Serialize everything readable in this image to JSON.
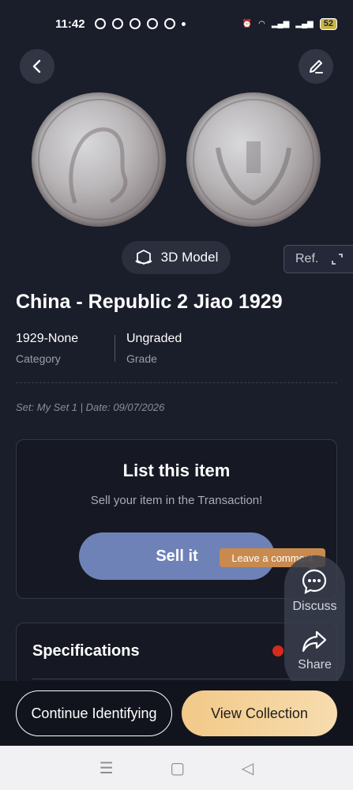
{
  "status": {
    "time": "11:42",
    "battery": "52"
  },
  "item": {
    "title": "China - Republic 2 Jiao 1929",
    "category_value": "1929-None",
    "category_label": "Category",
    "grade_value": "Ungraded",
    "grade_label": "Grade",
    "set_line": "Set: My Set 1 | Date: 09/07/2026"
  },
  "actions": {
    "model_3d": "3D Model",
    "ref": "Ref."
  },
  "list_card": {
    "title": "List this item",
    "subtitle": "Sell your item in the Transaction!",
    "sell_button": "Sell it"
  },
  "tooltip": "Leave a comment",
  "side_panel": {
    "discuss": "Discuss",
    "share": "Share"
  },
  "specs": {
    "title": "Specifications"
  },
  "footer": {
    "continue": "Continue Identifying",
    "view": "View Collection"
  },
  "colors": {
    "background": "#1a1d2a",
    "sell_button": "#6e82b8",
    "tooltip": "#c88a4e",
    "view_button": "#f2c988"
  }
}
